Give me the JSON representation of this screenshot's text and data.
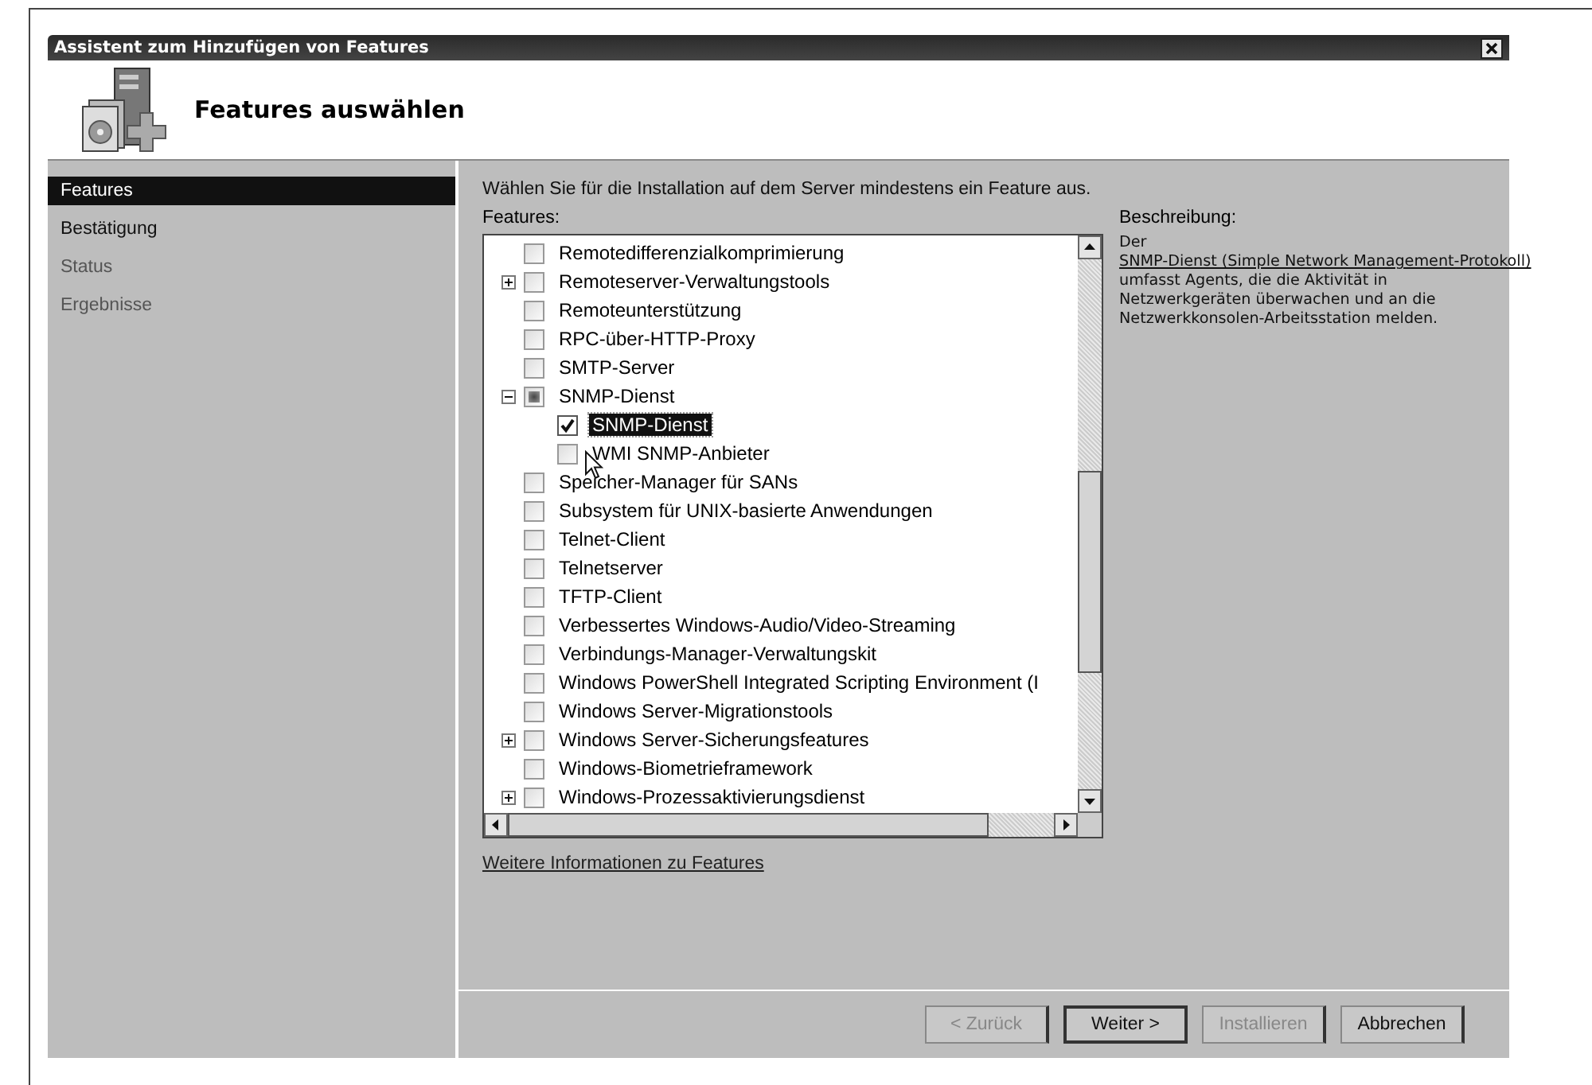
{
  "window": {
    "title": "Assistent zum Hinzufügen von Features"
  },
  "header": {
    "title": "Features auswählen"
  },
  "sidebar": {
    "items": [
      {
        "label": "Features",
        "selected": true,
        "disabled": false
      },
      {
        "label": "Bestätigung",
        "selected": false,
        "disabled": false
      },
      {
        "label": "Status",
        "selected": false,
        "disabled": true
      },
      {
        "label": "Ergebnisse",
        "selected": false,
        "disabled": true
      }
    ]
  },
  "instruction": "Wählen Sie für die Installation auf dem Server mindestens ein Feature aus.",
  "features": {
    "label": "Features:",
    "items": [
      {
        "label": "Remotedifferenzialkomprimierung",
        "checked": false,
        "mixed": false,
        "selected": false
      },
      {
        "label": "Remoteserver-Verwaltungstools",
        "checked": false,
        "mixed": false,
        "selected": false,
        "expanded": false
      },
      {
        "label": "Remoteunterstützung",
        "checked": false,
        "mixed": false,
        "selected": false
      },
      {
        "label": "RPC-über-HTTP-Proxy",
        "checked": false,
        "mixed": false,
        "selected": false
      },
      {
        "label": "SMTP-Server",
        "checked": false,
        "mixed": false,
        "selected": false
      },
      {
        "label": "SNMP-Dienst",
        "checked": false,
        "mixed": true,
        "selected": false,
        "expanded": true,
        "children": [
          {
            "label": "SNMP-Dienst",
            "checked": true,
            "mixed": false,
            "selected": true
          },
          {
            "label": "WMI SNMP-Anbieter",
            "checked": false,
            "mixed": false,
            "selected": false
          }
        ]
      },
      {
        "label": "Speicher-Manager für SANs",
        "checked": false,
        "mixed": false,
        "selected": false
      },
      {
        "label": "Subsystem für UNIX-basierte Anwendungen",
        "checked": false,
        "mixed": false,
        "selected": false
      },
      {
        "label": "Telnet-Client",
        "checked": false,
        "mixed": false,
        "selected": false
      },
      {
        "label": "Telnetserver",
        "checked": false,
        "mixed": false,
        "selected": false
      },
      {
        "label": "TFTP-Client",
        "checked": false,
        "mixed": false,
        "selected": false
      },
      {
        "label": "Verbessertes Windows-Audio/Video-Streaming",
        "checked": false,
        "mixed": false,
        "selected": false
      },
      {
        "label": "Verbindungs-Manager-Verwaltungskit",
        "checked": false,
        "mixed": false,
        "selected": false
      },
      {
        "label": "Windows PowerShell Integrated Scripting Environment (I",
        "checked": false,
        "mixed": false,
        "selected": false
      },
      {
        "label": "Windows Server-Migrationstools",
        "checked": false,
        "mixed": false,
        "selected": false
      },
      {
        "label": "Windows Server-Sicherungsfeatures",
        "checked": false,
        "mixed": false,
        "selected": false,
        "expanded": false
      },
      {
        "label": "Windows-Biometrieframework",
        "checked": false,
        "mixed": false,
        "selected": false
      },
      {
        "label": "Windows-Prozessaktivierungsdienst",
        "checked": false,
        "mixed": false,
        "selected": false,
        "expanded": false
      }
    ]
  },
  "more_info_link": "Weitere Informationen zu Features",
  "description": {
    "label": "Beschreibung:",
    "before": "Der",
    "link": "SNMP-Dienst (Simple Network Management-Protokoll)",
    "after": "umfasst Agents, die die Aktivität in Netzwerkgeräten überwachen und an die Netzwerkkonsolen-Arbeitsstation melden."
  },
  "buttons": [
    {
      "label": "< Zurück",
      "disabled": true,
      "default": false
    },
    {
      "label": "Weiter >",
      "disabled": false,
      "default": true
    },
    {
      "label": "Installieren",
      "disabled": true,
      "default": false
    },
    {
      "label": "Abbrechen",
      "disabled": false,
      "default": false
    }
  ]
}
